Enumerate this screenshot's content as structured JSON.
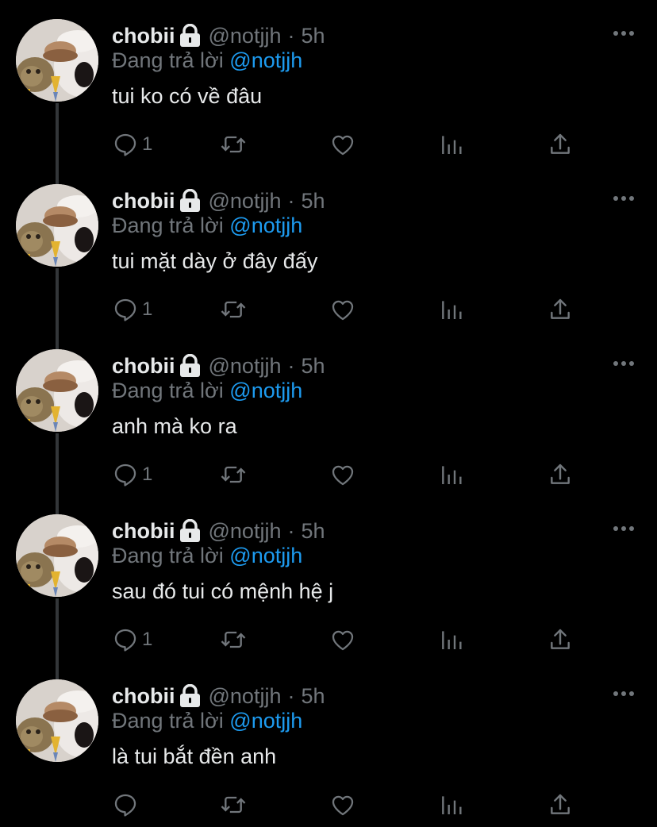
{
  "colors": {
    "background": "#000000",
    "primary_text": "#e7e9ea",
    "secondary_text": "#71767b",
    "mention": "#1d9bf0",
    "thread_line": "#333639"
  },
  "tweets": [
    {
      "display_name": "chobii",
      "handle": "@notjjh",
      "separator": "·",
      "time": "5h",
      "replying_prefix": "Đang trả lời",
      "replying_to": "@notjjh",
      "text": "tui ko có về đâu",
      "reply_count": "1",
      "icons": [
        "lock-icon",
        "more-icon",
        "reply-icon",
        "retweet-icon",
        "like-icon",
        "analytics-icon",
        "share-icon"
      ]
    },
    {
      "display_name": "chobii",
      "handle": "@notjjh",
      "separator": "·",
      "time": "5h",
      "replying_prefix": "Đang trả lời",
      "replying_to": "@notjjh",
      "text": "tui mặt dày ở đây đấy",
      "reply_count": "1",
      "icons": [
        "lock-icon",
        "more-icon",
        "reply-icon",
        "retweet-icon",
        "like-icon",
        "analytics-icon",
        "share-icon"
      ]
    },
    {
      "display_name": "chobii",
      "handle": "@notjjh",
      "separator": "·",
      "time": "5h",
      "replying_prefix": "Đang trả lời",
      "replying_to": "@notjjh",
      "text": "anh mà ko ra",
      "reply_count": "1",
      "icons": [
        "lock-icon",
        "more-icon",
        "reply-icon",
        "retweet-icon",
        "like-icon",
        "analytics-icon",
        "share-icon"
      ]
    },
    {
      "display_name": "chobii",
      "handle": "@notjjh",
      "separator": "·",
      "time": "5h",
      "replying_prefix": "Đang trả lời",
      "replying_to": "@notjjh",
      "text": "sau đó tui có mệnh hệ j",
      "reply_count": "1",
      "icons": [
        "lock-icon",
        "more-icon",
        "reply-icon",
        "retweet-icon",
        "like-icon",
        "analytics-icon",
        "share-icon"
      ]
    },
    {
      "display_name": "chobii",
      "handle": "@notjjh",
      "separator": "·",
      "time": "5h",
      "replying_prefix": "Đang trả lời",
      "replying_to": "@notjjh",
      "text": "là tui bắt đền anh",
      "reply_count": "",
      "icons": [
        "lock-icon",
        "more-icon",
        "reply-icon",
        "retweet-icon",
        "like-icon",
        "analytics-icon",
        "share-icon"
      ]
    }
  ]
}
